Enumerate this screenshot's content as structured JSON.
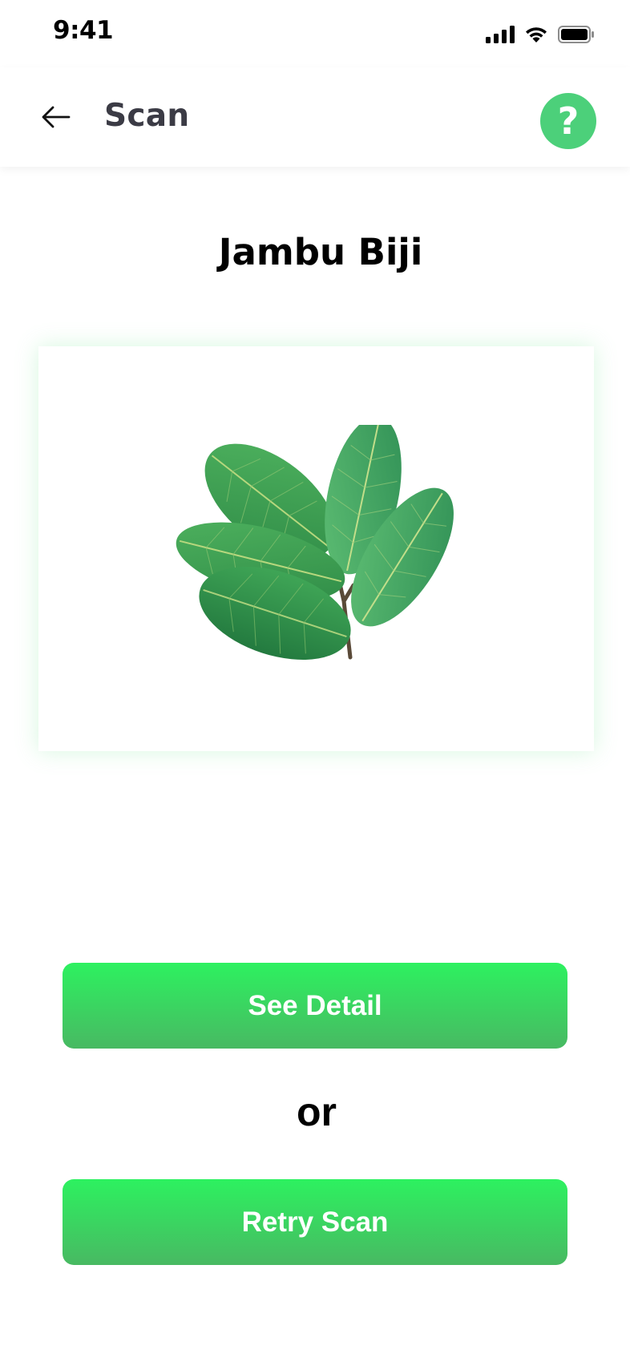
{
  "status_bar": {
    "time": "9:41",
    "icons": [
      "signal-icon",
      "wifi-icon",
      "battery-icon"
    ]
  },
  "header": {
    "back_icon": "arrow-left-icon",
    "title": "Scan",
    "help_icon": "question-icon",
    "help_glyph": "?",
    "help_color": "#4cd07a"
  },
  "result": {
    "plant_name": "Jambu Biji",
    "image_icon": "guava-leaves-image"
  },
  "actions": {
    "see_detail_label": "See Detail",
    "separator_text": "or",
    "retry_label": "Retry Scan",
    "button_gradient_top": "#2df160",
    "button_gradient_bottom": "#48b962"
  }
}
